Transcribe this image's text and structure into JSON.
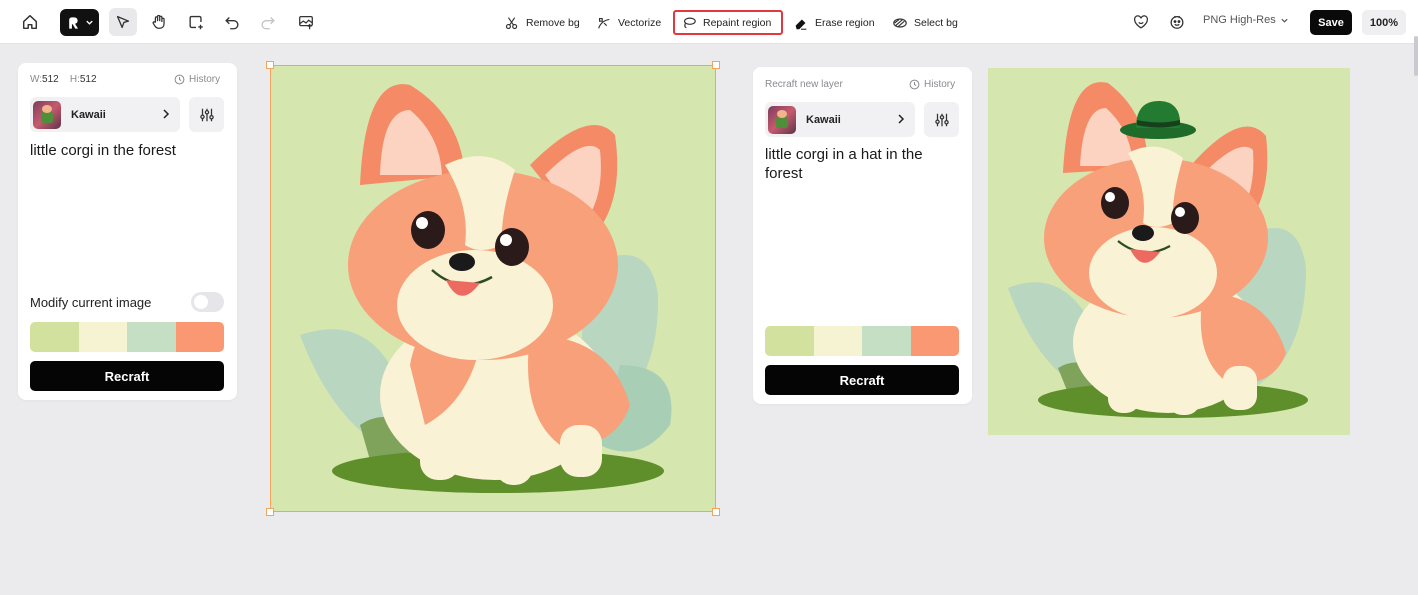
{
  "toolbar": {
    "tools": {
      "remove_bg": "Remove bg",
      "vectorize": "Vectorize",
      "repaint_region": "Repaint region",
      "erase_region": "Erase region",
      "select_bg": "Select bg"
    },
    "export_format": "PNG High-Res",
    "save_label": "Save",
    "zoom": "100%",
    "active_tool": "repaint_region"
  },
  "left_panel": {
    "width_label": "W:",
    "width_value": "512",
    "height_label": "H:",
    "height_value": "512",
    "history_label": "History",
    "style_name": "Kawaii",
    "prompt": "little corgi in the forest",
    "modify_label": "Modify current image",
    "modify_enabled": false,
    "palette": [
      "#d2e29e",
      "#f5f3d2",
      "#c5dfc4",
      "#fa9874"
    ],
    "button_label": "Recraft"
  },
  "right_panel": {
    "title": "Recraft new layer",
    "history_label": "History",
    "style_name": "Kawaii",
    "prompt": "little corgi in a hat in the forest",
    "palette": [
      "#d2e29e",
      "#f5f3d2",
      "#c5dfc4",
      "#fa9874"
    ],
    "button_label": "Recraft"
  },
  "colors": {
    "accent_red": "#e0393e",
    "selection": "#f2a35d",
    "image_bg": "#d5e6ae"
  },
  "images": {
    "canvas_image": "corgi-kawaii-illustration",
    "result_image": "corgi-with-green-hat-illustration"
  }
}
